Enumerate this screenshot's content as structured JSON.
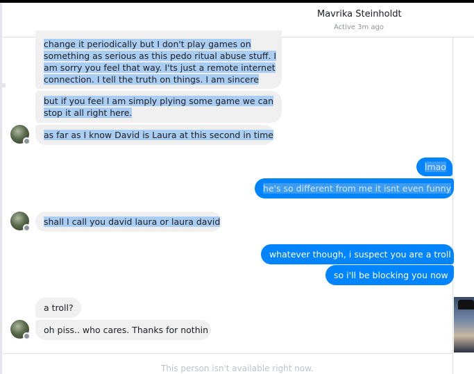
{
  "header": {
    "name": "Mavrika Steinholdt",
    "status": "Active 3m ago"
  },
  "messages_in_top": [
    {
      "lines": [
        "change it periodically but I don't play games on",
        "something as serious as this pedo ritual abuse stuff. I",
        "am sorry you feel that way. I'ts just a remote internet",
        "connection. I tell the truth on things. I am sincere"
      ]
    },
    {
      "lines": [
        "but if you feel I am simply plying some game we can",
        "stop it all right here."
      ]
    },
    {
      "text": "as far as I know David is Laura at this second in time"
    }
  ],
  "messages_out_1": [
    {
      "text": "lmao"
    },
    {
      "text": "he's so different from me it isnt even funny"
    }
  ],
  "message_in_2": {
    "text": "shall I call you david laura or laura david"
  },
  "messages_out_2": [
    {
      "text": "whatever though, i suspect you are a troll"
    },
    {
      "text": "so i'll be blocking you now"
    }
  ],
  "messages_in_3": [
    {
      "text": "a troll?"
    },
    {
      "text": "oh piss.. who cares. Thanks for nothin"
    }
  ],
  "footer": {
    "note": "This person isn't available right now."
  },
  "colors": {
    "outgoing_bubble": "#0084ff",
    "incoming_bubble": "#f1f0f0",
    "selection_highlight": "#a9cdf3"
  },
  "icons": {
    "avatar": "contact-avatar",
    "badge": "messenger-badge-icon",
    "thumbnail": "own-profile-thumbnail"
  }
}
